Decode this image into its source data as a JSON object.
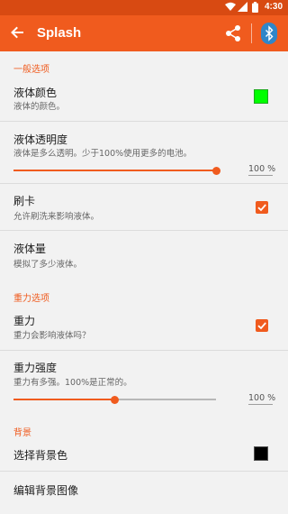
{
  "status_bar": {
    "time": "4:30",
    "icons": [
      "wifi-icon",
      "signal-icon",
      "battery-icon"
    ]
  },
  "app_bar": {
    "title": "Splash",
    "back_icon": "arrow-left-icon",
    "share_icon": "share-icon",
    "bluetooth_icon": "bluetooth-icon"
  },
  "colors": {
    "accent": "#f05b1e",
    "status_bar": "#d84a12",
    "liquid_color": "#00ff00",
    "background_color": "#000000"
  },
  "sections": {
    "general": {
      "header": "一般选项",
      "liquid_color": {
        "title": "液体颜色",
        "summary": "液体的颜色。"
      },
      "liquid_opacity": {
        "title": "液体透明度",
        "summary": "液体是多么透明。少于100%使用更多的电池。",
        "value_label": "100 %",
        "value_fraction": 1.0
      },
      "swipe": {
        "title": "刷卡",
        "summary": "允许刷洗来影响液体。",
        "checked": true
      },
      "liquid_amount": {
        "title": "液体量",
        "summary": "模拟了多少液体。"
      }
    },
    "gravity": {
      "header": "重力选项",
      "gravity": {
        "title": "重力",
        "summary": "重力会影响液体吗？",
        "checked": true
      },
      "gravity_strength": {
        "title": "重力强度",
        "summary": "重力有多强。100%是正常的。",
        "value_label": "100 %",
        "value_fraction": 0.5
      }
    },
    "background": {
      "header": "背景",
      "choose_color": {
        "title": "选择背景色"
      },
      "edit_image": {
        "title": "编辑背景图像"
      }
    }
  }
}
